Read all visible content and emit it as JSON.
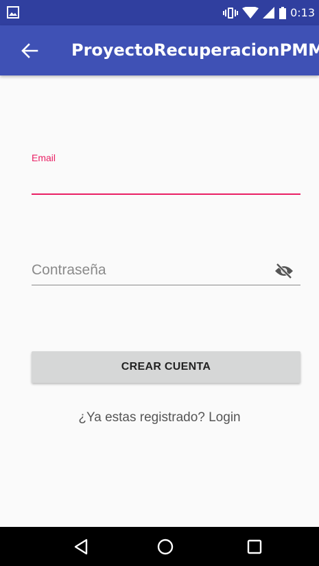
{
  "theme": {
    "status_color": "#303f9f",
    "primary_color": "#3f51b5",
    "accent_color": "#e91e63",
    "background_color": "#fafafa",
    "button_color": "#d6d7d7",
    "navbar_color": "#000000"
  },
  "statusbar": {
    "time": "0:13",
    "icons": [
      "image-icon",
      "vibrate-icon",
      "wifi-icon",
      "signal-icon",
      "battery-icon"
    ]
  },
  "appbar": {
    "title": "ProyectoRecuperacionPMM",
    "back_icon": "arrow-back-icon"
  },
  "form": {
    "email_label": "Email",
    "email_value": "",
    "password_placeholder": "Contraseña",
    "password_value": "",
    "visibility_icon": "visibility-off-icon",
    "create_button_label": "CREAR CUENTA",
    "login_link_text": "¿Ya estas registrado? Login"
  },
  "navbar": {
    "icons": [
      "nav-back-icon",
      "nav-home-icon",
      "nav-recents-icon"
    ]
  }
}
